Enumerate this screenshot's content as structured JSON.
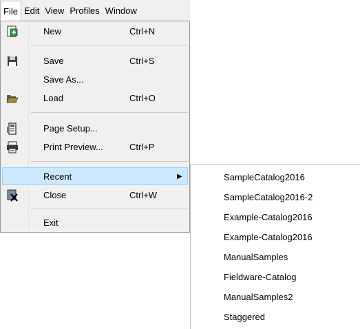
{
  "menubar": {
    "items": [
      {
        "label": "File"
      },
      {
        "label": "Edit"
      },
      {
        "label": "View"
      },
      {
        "label": "Profiles"
      },
      {
        "label": "Window"
      }
    ]
  },
  "file_menu": {
    "items": [
      {
        "label": "New",
        "shortcut": "Ctrl+N",
        "icon": "new-icon"
      },
      {
        "label": "Save",
        "shortcut": "Ctrl+S",
        "icon": "save-icon"
      },
      {
        "label": "Save As...",
        "shortcut": "",
        "icon": ""
      },
      {
        "label": "Load",
        "shortcut": "Ctrl+O",
        "icon": "folder-open-icon"
      },
      {
        "label": "Page Setup...",
        "shortcut": "",
        "icon": "page-setup-icon"
      },
      {
        "label": "Print Preview...",
        "shortcut": "Ctrl+P",
        "icon": "print-preview-icon"
      },
      {
        "label": "Recent",
        "shortcut": "",
        "icon": "",
        "submenu_arrow": "▶",
        "highlighted": true
      },
      {
        "label": "Close",
        "shortcut": "Ctrl+W",
        "icon": "close-document-icon"
      },
      {
        "label": "Exit",
        "shortcut": "",
        "icon": ""
      }
    ]
  },
  "recent_submenu": {
    "items": [
      "SampleCatalog2016",
      "SampleCatalog2016-2",
      "Example-Catalog2016",
      "Example-Catalog2016",
      "ManualSamples",
      "Fieldware-Catalog",
      "ManualSamples2",
      "Staggered"
    ]
  },
  "colors": {
    "menu_bg": "#f0f0f0",
    "highlight_bg": "#cce8ff",
    "highlight_border": "#99d1ff",
    "new_icon_green": "#2e9e3e",
    "close_icon_x": "#000000"
  }
}
